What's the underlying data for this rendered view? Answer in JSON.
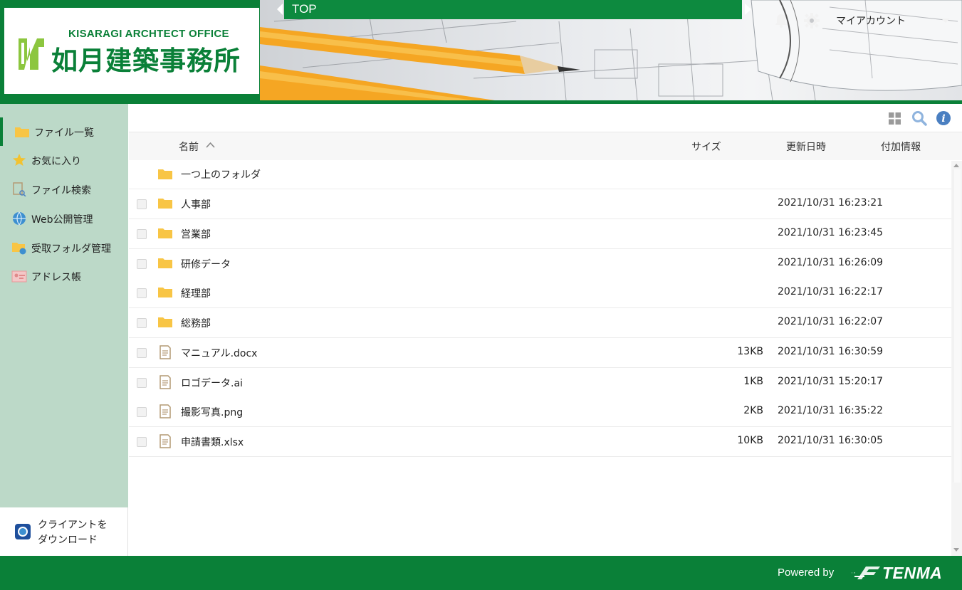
{
  "header": {
    "logo_en": "KISARAGI ARCHTECT OFFICE",
    "logo_jp": "如月建築事務所",
    "breadcrumb": "TOP",
    "account_label": "マイアカウント",
    "icons": [
      "bell-icon",
      "gear-icon",
      "chevron-down-icon"
    ]
  },
  "sidebar": {
    "items": [
      {
        "label": "ファイル一覧",
        "icon": "folder-icon",
        "active": true
      },
      {
        "label": "お気に入り",
        "icon": "star-icon",
        "active": false
      },
      {
        "label": "ファイル検索",
        "icon": "file-search-icon",
        "active": false
      },
      {
        "label": "Web公開管理",
        "icon": "globe-icon",
        "active": false
      },
      {
        "label": "受取フォルダ管理",
        "icon": "folder-globe-icon",
        "active": false
      },
      {
        "label": "アドレス帳",
        "icon": "address-card-icon",
        "active": false
      }
    ],
    "client_download": {
      "line1": "クライアントを",
      "line2": "ダウンロード"
    }
  },
  "toolbar": {
    "icons": [
      "grid-view-icon",
      "search-icon",
      "info-icon"
    ]
  },
  "table": {
    "columns": {
      "name": "名前",
      "size": "サイズ",
      "modified": "更新日時",
      "extra": "付加情報"
    },
    "sort": {
      "column": "name",
      "direction": "asc"
    },
    "parent_folder": "一つ上のフォルダ",
    "rows": [
      {
        "type": "folder",
        "name": "人事部",
        "size": "",
        "modified": "2021/10/31 16:23:21"
      },
      {
        "type": "folder",
        "name": "営業部",
        "size": "",
        "modified": "2021/10/31 16:23:45"
      },
      {
        "type": "folder",
        "name": "研修データ",
        "size": "",
        "modified": "2021/10/31 16:26:09"
      },
      {
        "type": "folder",
        "name": "経理部",
        "size": "",
        "modified": "2021/10/31 16:22:17"
      },
      {
        "type": "folder",
        "name": "総務部",
        "size": "",
        "modified": "2021/10/31 16:22:07"
      },
      {
        "type": "file",
        "name": "マニュアル.docx",
        "size": "13KB",
        "modified": "2021/10/31 16:30:59"
      },
      {
        "type": "file",
        "name": "ロゴデータ.ai",
        "size": "1KB",
        "modified": "2021/10/31 15:20:17"
      },
      {
        "type": "file",
        "name": "撮影写真.png",
        "size": "2KB",
        "modified": "2021/10/31 16:35:22"
      },
      {
        "type": "file",
        "name": "申請書類.xlsx",
        "size": "10KB",
        "modified": "2021/10/31 16:30:05"
      }
    ]
  },
  "footer": {
    "powered_by": "Powered by",
    "brand": "TENMA"
  },
  "colors": {
    "brand_green": "#0a8038",
    "sidebar_bg": "#bcd9c8",
    "folder_yellow": "#f8c545",
    "file_icon": "#b49a74",
    "info_blue": "#4a7fc1"
  }
}
